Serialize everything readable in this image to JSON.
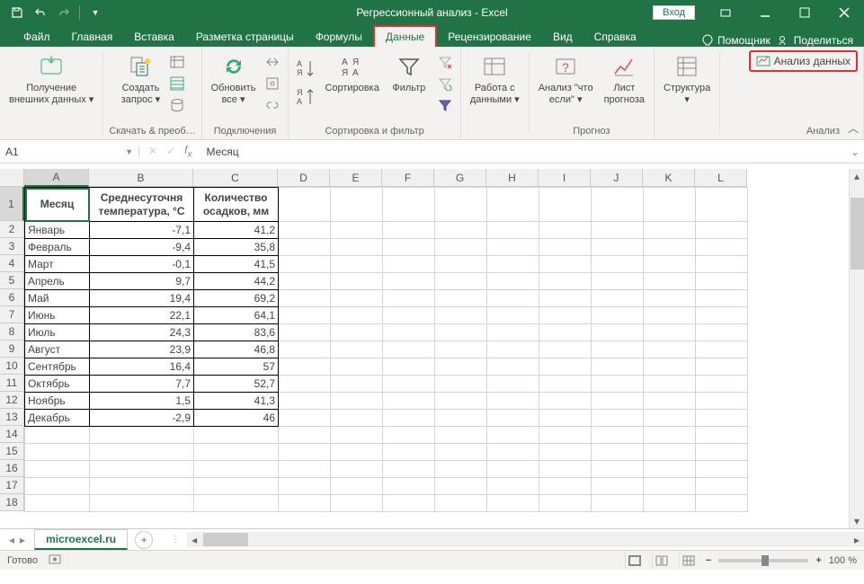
{
  "title": "Регрессионный анализ  -  Excel",
  "login": "Вход",
  "tabs": {
    "file": "Файл",
    "home": "Главная",
    "insert": "Вставка",
    "layout": "Разметка страницы",
    "formulas": "Формулы",
    "data": "Данные",
    "review": "Рецензирование",
    "view": "Вид",
    "help": "Справка",
    "tellme": "Помощник",
    "share": "Поделиться"
  },
  "ribbon": {
    "get_external": "Получение\nвнешних данных ▾",
    "new_query": "Создать\nзапрос ▾",
    "group_get": "Скачать & преоб…",
    "refresh_all": "Обновить\nвсе ▾",
    "group_conn": "Подключения",
    "sort": "Сортировка",
    "filter": "Фильтр",
    "group_sortfilter": "Сортировка и фильтр",
    "data_tools": "Работа с\nданными ▾",
    "whatif": "Анализ \"что\nесли\" ▾",
    "forecast_sheet": "Лист\nпрогноза",
    "group_forecast": "Прогноз",
    "outline": "Структура\n▾",
    "data_analysis": "Анализ данных",
    "group_analysis": "Анализ"
  },
  "namebox": "A1",
  "formula": "Месяц",
  "columns": [
    "A",
    "B",
    "C",
    "D",
    "E",
    "F",
    "G",
    "H",
    "I",
    "J",
    "K",
    "L"
  ],
  "header_row": {
    "a": "Месяц",
    "b": "Среднесуточня температура, °C",
    "c": "Количество осадков, мм"
  },
  "rows": [
    {
      "m": "Январь",
      "t": "-7,1",
      "p": "41,2"
    },
    {
      "m": "Февраль",
      "t": "-9,4",
      "p": "35,8"
    },
    {
      "m": "Март",
      "t": "-0,1",
      "p": "41,5"
    },
    {
      "m": "Апрель",
      "t": "9,7",
      "p": "44,2"
    },
    {
      "m": "Май",
      "t": "19,4",
      "p": "69,2"
    },
    {
      "m": "Июнь",
      "t": "22,1",
      "p": "64,1"
    },
    {
      "m": "Июль",
      "t": "24,3",
      "p": "83,6"
    },
    {
      "m": "Август",
      "t": "23,9",
      "p": "46,8"
    },
    {
      "m": "Сентябрь",
      "t": "16,4",
      "p": "57"
    },
    {
      "m": "Октябрь",
      "t": "7,7",
      "p": "52,7"
    },
    {
      "m": "Ноябрь",
      "t": "1,5",
      "p": "41,3"
    },
    {
      "m": "Декабрь",
      "t": "-2,9",
      "p": "46"
    }
  ],
  "sheet_tab": "microexcel.ru",
  "status": "Готово",
  "zoom": "100 %"
}
